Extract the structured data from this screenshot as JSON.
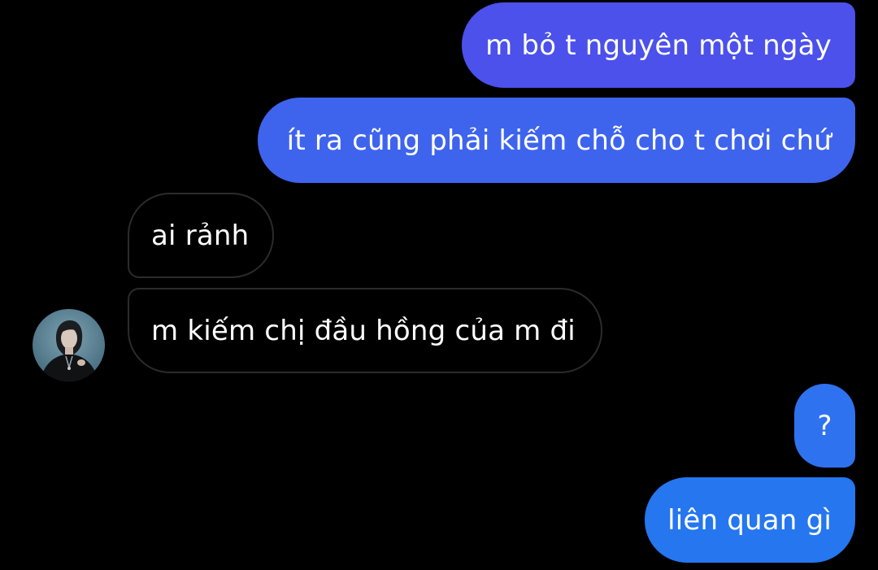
{
  "conversation": {
    "messages": [
      {
        "sender": "me",
        "text": "m bỏ t nguyên một ngày"
      },
      {
        "sender": "me",
        "text": "ít ra cũng phải kiếm chỗ cho t chơi chứ"
      },
      {
        "sender": "other",
        "text": "ai rảnh"
      },
      {
        "sender": "other",
        "text": "m kiếm chị đầu hồng của m đi"
      },
      {
        "sender": "me",
        "text": "?"
      },
      {
        "sender": "me",
        "text": "liên quan gì"
      }
    ]
  },
  "colors": {
    "background": "#000000",
    "outgoing_gradient_top": "#4b51ea",
    "outgoing_gradient_bottom": "#2576ef",
    "incoming_border": "#2b2b2b"
  },
  "icons": {
    "avatar": "contact-avatar-photo"
  }
}
